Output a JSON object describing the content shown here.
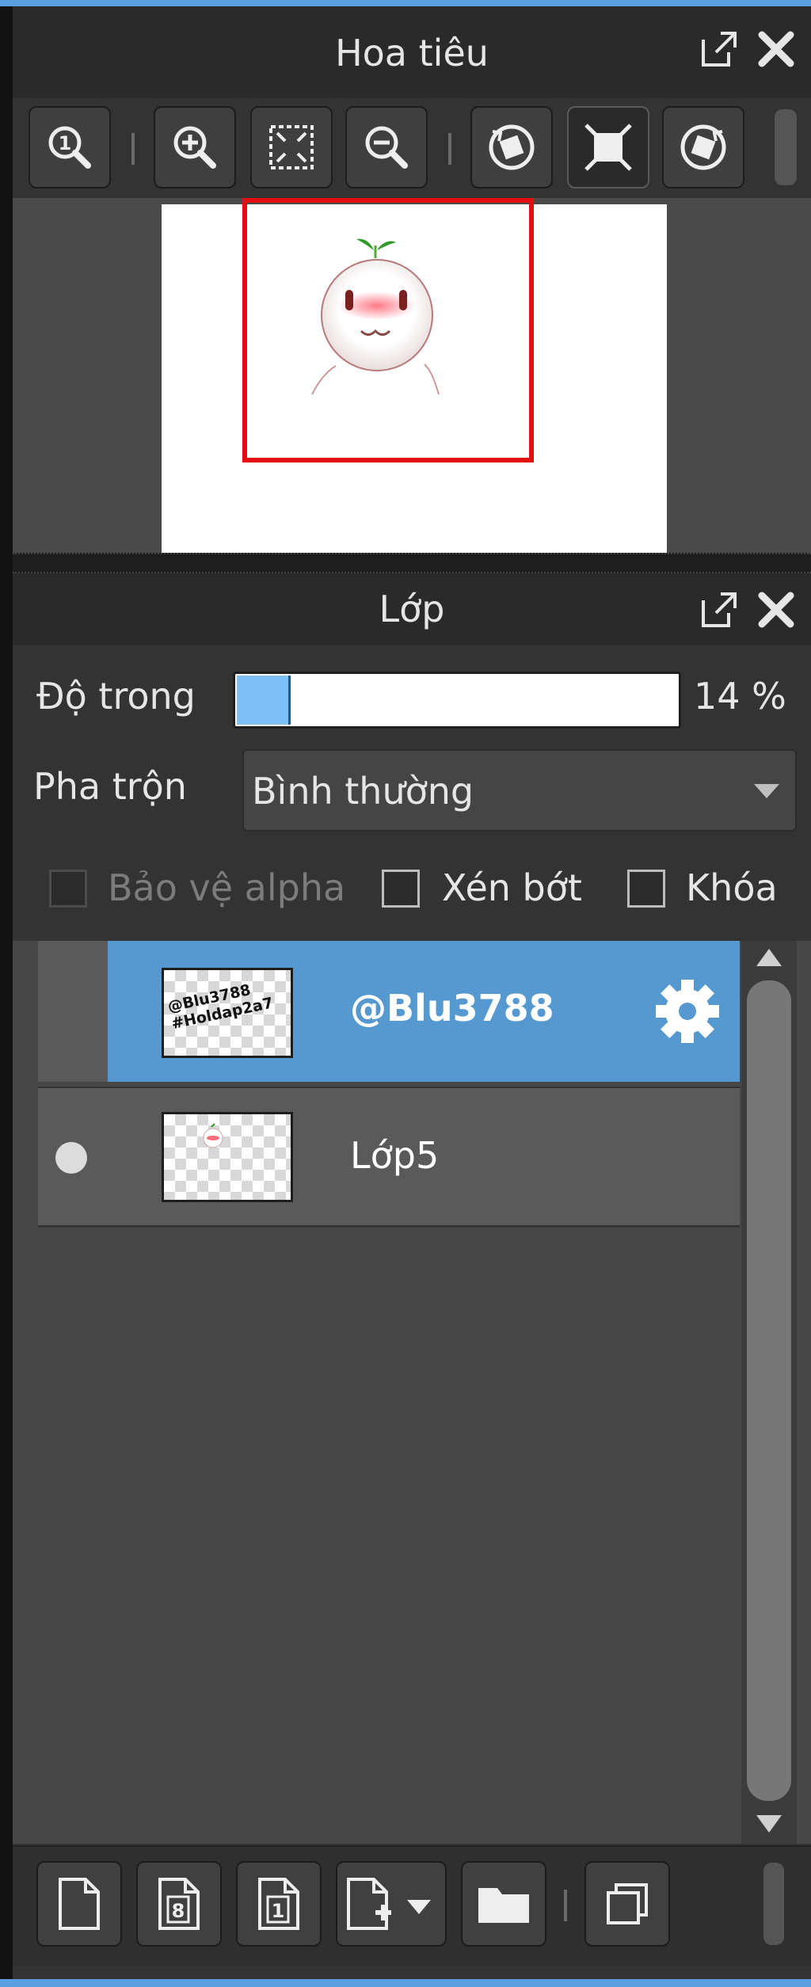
{
  "navigator": {
    "title": "Hoa tiêu",
    "tools": [
      {
        "name": "actual-size-icon"
      },
      {
        "name": "zoom-in-icon"
      },
      {
        "name": "fit-screen-icon"
      },
      {
        "name": "zoom-out-icon"
      },
      {
        "name": "rotate-left-icon"
      },
      {
        "name": "fit-window-icon"
      },
      {
        "name": "rotate-right-icon"
      }
    ],
    "preview_colors": {
      "canvas": "#ffffff",
      "viewport_frame": "#e01010"
    }
  },
  "layers": {
    "title": "Lớp",
    "opacity": {
      "label": "Độ trong",
      "value": 14,
      "text": "14 %"
    },
    "blend": {
      "label": "Pha trộn",
      "selected": "Bình thường"
    },
    "options": [
      {
        "label": "Bảo vệ alpha",
        "checked": false,
        "disabled": true
      },
      {
        "label": "Xén bớt",
        "checked": false,
        "disabled": false
      },
      {
        "label": "Khóa",
        "checked": false,
        "disabled": false
      }
    ],
    "items": [
      {
        "name": "@Blu3788",
        "selected": true,
        "thumb_text_1": "@Blu3788",
        "thumb_text_2": "#Holdap2a7"
      },
      {
        "name": "Lớp5",
        "selected": false,
        "visible": true
      }
    ],
    "colors": {
      "selected": "#5599d0",
      "row": "#5a5a5a",
      "list_bg": "#474747",
      "accent": "#5a9fe0"
    }
  },
  "bottom_toolbar": {
    "tools": [
      {
        "name": "new-layer-icon"
      },
      {
        "name": "new-8bit-layer-icon"
      },
      {
        "name": "new-1bit-layer-icon"
      },
      {
        "name": "add-layer-menu-icon"
      },
      {
        "name": "folder-icon"
      },
      {
        "name": "duplicate-layer-icon"
      }
    ]
  }
}
